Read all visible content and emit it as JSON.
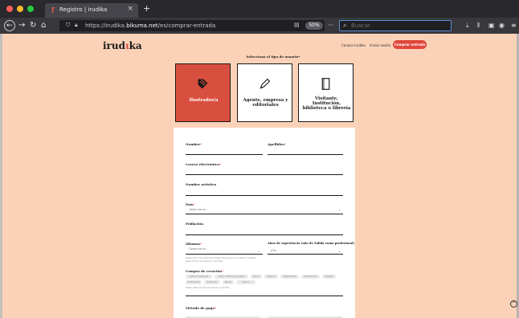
{
  "browser": {
    "tab_title": "Registro | irudika",
    "tab_favicon": "ɼ",
    "new_tab": "+",
    "close_tab": "×",
    "url_prefix": "https://irudika.",
    "url_domain": "bikuma.net",
    "url_path": "/es/comprar-entrada",
    "zoom": "50%",
    "more": "···",
    "search_placeholder": "Buscar"
  },
  "header": {
    "logo_left": "irud",
    "logo_k": "ɩ",
    "logo_right": "ka",
    "nav_about": "Conoce irudika",
    "nav_login": "Iniciar sesión",
    "cta": "Comprar entrada"
  },
  "user_type": {
    "title": "Selecciona el tipo de usuario*",
    "cards": [
      {
        "label": "Ilustrador/a"
      },
      {
        "label": "Agente, empresa y editoriales"
      },
      {
        "label": "Visitante, Institución, biblioteca o librería"
      }
    ]
  },
  "form": {
    "nombre": "Nombre",
    "apellidos": "Apellidos",
    "email": "Correo electrónico",
    "artistico": "Nombre artístico",
    "pais": "País",
    "pais_select": "- Seleccionar -",
    "poblacion": "Población",
    "idiomas": "Idiomas",
    "idiomas_select": "- Seleccionar -",
    "idiomas_help": "Selecciona los idiomas preferidos para el contacto. Debes seleccionar al menos 1 idioma.",
    "experiencia": "Años de experiencia (año de Salida como profesional)",
    "experiencia_select": "Año",
    "campos": "Campos de creación",
    "chips": [
      "Álbum ilustrado",
      "Libro infantil y juvenil",
      "Cómic",
      "Prensa",
      "Publicidad",
      "Animación",
      "Diseño",
      "Ilustración",
      "Editorial",
      "Mural",
      "Otros"
    ],
    "campos_help": "Debe seleccionar al menos 1 opción.",
    "pago": "Método de pago"
  },
  "colors": {
    "page_bg": "#fbd2b8",
    "accent": "#d94f3f",
    "cta": "#e0473a"
  },
  "icons": {
    "illustrator": "palette-icon",
    "agent": "pen-icon",
    "visitor": "book-icon"
  }
}
